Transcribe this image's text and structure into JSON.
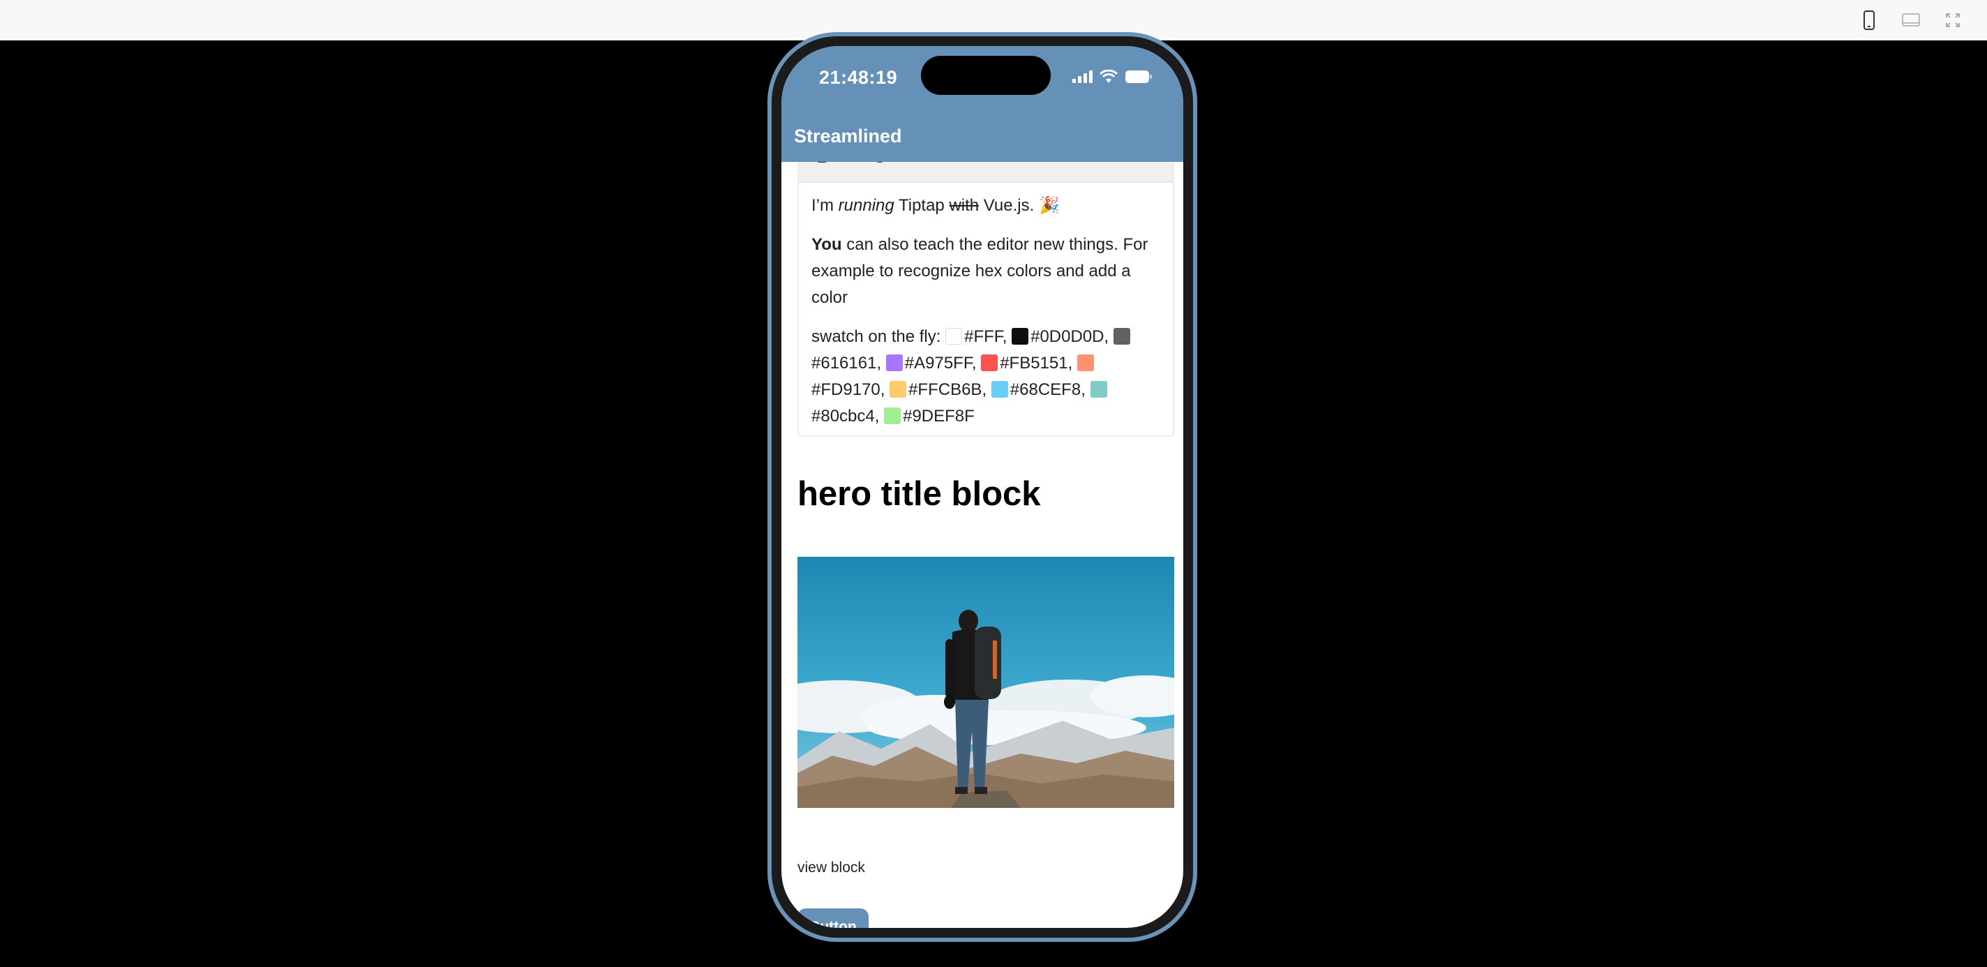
{
  "toolbar_icons": [
    "phone-device-icon",
    "tablet-device-icon",
    "fullscreen-icon"
  ],
  "status_bar": {
    "time": "21:48:19",
    "icons": [
      "signal-icon",
      "wifi-icon",
      "battery-icon"
    ]
  },
  "app": {
    "title": "Streamlined",
    "accent_color": "#6591b8"
  },
  "editor": {
    "toolbar": {
      "bold": "B",
      "italic": "I",
      "strike": "S"
    },
    "line1": {
      "prefix": "I’m ",
      "italic": "running",
      "mid": " Tiptap ",
      "strike": "with",
      "suffix": " Vue.js. 🎉"
    },
    "line2": {
      "bold": "You",
      "rest": " can also teach the editor new things. For example to recognize hex colors and add a color"
    },
    "line3_prefix": "swatch on the fly: ",
    "colors": [
      "#FFF",
      "#0D0D0D",
      "#616161",
      "#A975FF",
      "#FB5151",
      "#FD9170",
      "#FFCB6B",
      "#68CEF8",
      "#80cbc4",
      "#9DEF8F"
    ]
  },
  "hero": {
    "title": "hero title block",
    "image_alt": "hiker-with-backpack-on-mountain"
  },
  "view_block": "view block",
  "button_label": "Button"
}
